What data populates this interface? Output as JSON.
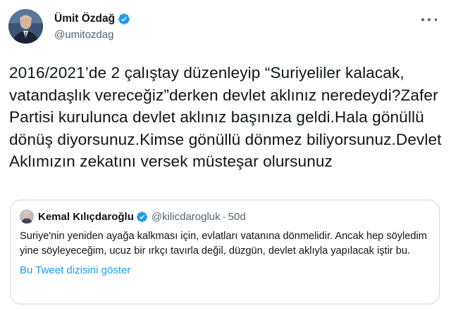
{
  "author": {
    "name": "Ümit Özdağ",
    "handle": "@umitozdag",
    "verified": true,
    "avatar_icon": "profile-photo"
  },
  "tweet": {
    "text": "2016/2021’de 2 çalıştay düzenleyip “Suriyeliler kalacak, vatandaşlık vereceğiz”derken devlet aklınız neredeydi?Zafer Partisi kurulunca devlet aklınız başınıza geldi.Hala gönüllü dönüş diyorsunuz.Kimse gönüllü dönmez biliyorsunuz.Devlet Aklımızın zekatını versek müsteşar olursunuz"
  },
  "quoted_tweet": {
    "name": "Kemal Kılıçdaroğlu",
    "handle": "@kilicdarogluk",
    "separator": "·",
    "time": "50d",
    "verified": true,
    "text": "Suriye'nin yeniden ayağa kalkması için, evlatları vatanına dönmelidir. Ancak hep söyledim yine söyleyeceğim, ucuz bir ırkçı tavırla değil, düzgün, devlet aklıyla yapılacak iştir bu.",
    "show_thread_label": "Bu Tweet dizisini göster"
  },
  "colors": {
    "text": "#0f1419",
    "secondary": "#536471",
    "link": "#1d9bf0",
    "border": "#cfd9de",
    "verified": "#1d9bf0"
  }
}
